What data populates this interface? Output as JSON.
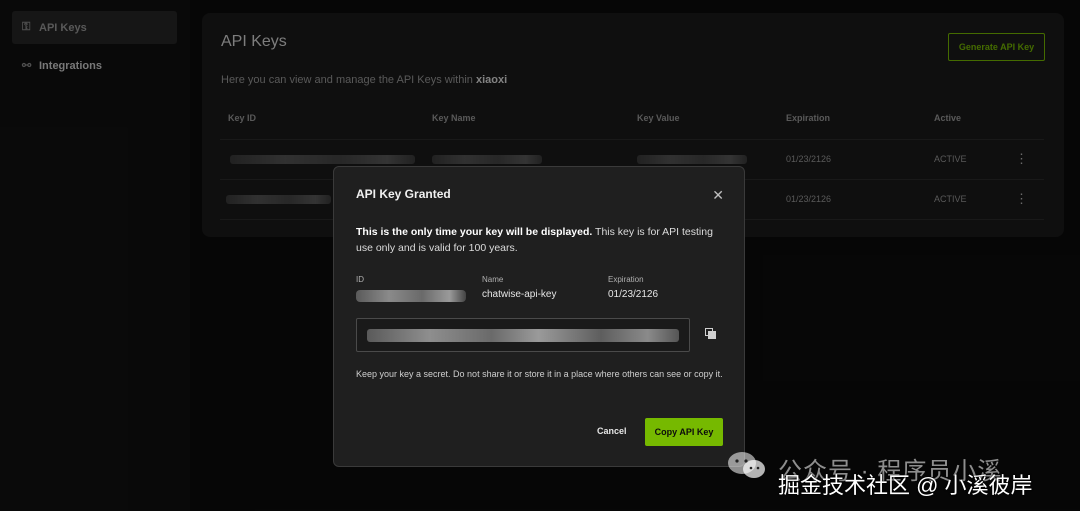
{
  "sidebar": {
    "items": [
      {
        "label": "API Keys",
        "icon": "key-icon",
        "active": true
      },
      {
        "label": "Integrations",
        "icon": "integrations-icon",
        "active": false
      }
    ]
  },
  "main": {
    "title": "API Keys",
    "subtitle_prefix": "Here you can view and manage the API Keys within ",
    "org": "xiaoxi",
    "generate_label": "Generate API Key",
    "columns": [
      "Key ID",
      "Key Name",
      "Key Value",
      "Expiration",
      "Active"
    ],
    "rows": [
      {
        "expiration": "01/23/2126",
        "status": "ACTIVE"
      },
      {
        "expiration": "01/23/2126",
        "status": "ACTIVE"
      }
    ]
  },
  "modal": {
    "title": "API Key Granted",
    "message_bold": "This is the only time your key will be displayed.",
    "message_rest": " This key is for API testing use only and is valid for 100 years.",
    "id_label": "ID",
    "name_label": "Name",
    "name_value": "chatwise-api-key",
    "expiration_label": "Expiration",
    "expiration_value": "01/23/2126",
    "note": "Keep your key a secret. Do not share it or store it in a place where others can see or copy it.",
    "cancel_label": "Cancel",
    "copy_label": "Copy API Key"
  },
  "watermark": {
    "line1": "公众号 · 程序员小溪",
    "line2": "掘金技术社区 @ 小溪彼岸"
  },
  "colors": {
    "accent": "#76b900",
    "background": "#0c0c0c",
    "panel": "#1a1a1a",
    "modal": "#1f1f1f"
  }
}
